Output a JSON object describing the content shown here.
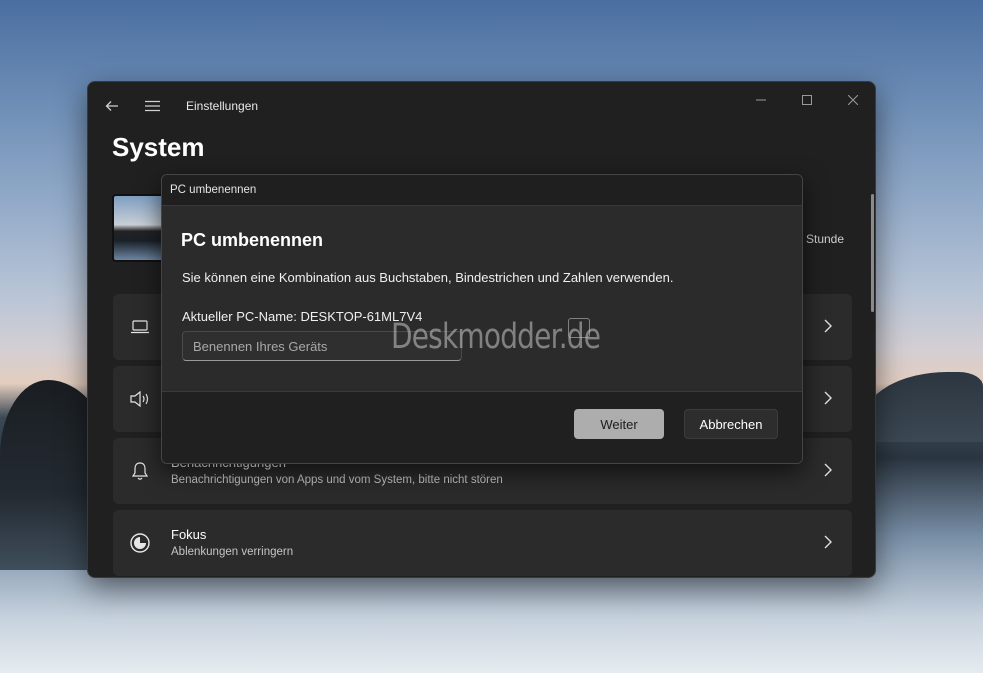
{
  "window": {
    "app_title": "Einstellungen",
    "page_title": "System",
    "stunde_text": "Stunde"
  },
  "cards": [
    {
      "icon": "laptop-icon",
      "title": "",
      "subtitle": ""
    },
    {
      "icon": "speaker-icon",
      "title": "",
      "subtitle": ""
    },
    {
      "icon": "bell-icon",
      "title": "Benachrichtigungen",
      "subtitle": "Benachrichtigungen von Apps und vom System, bitte nicht stören"
    },
    {
      "icon": "focus-icon",
      "title": "Fokus",
      "subtitle": "Ablenkungen verringern"
    }
  ],
  "dialog": {
    "window_title": "PC umbenennen",
    "heading": "PC umbenennen",
    "description": "Sie können eine Kombination aus Buchstaben, Bindestrichen und Zahlen verwenden.",
    "current_name": "Aktueller PC-Name: DESKTOP-61ML7V4",
    "input_placeholder": "Benennen Ihres Geräts",
    "input_value": "",
    "next_label": "Weiter",
    "cancel_label": "Abbrechen"
  },
  "watermark": "Deskmodder.de",
  "colors": {
    "window_bg": "#202020",
    "card_bg": "#2b2b2b",
    "primary_button": "#adadad"
  }
}
